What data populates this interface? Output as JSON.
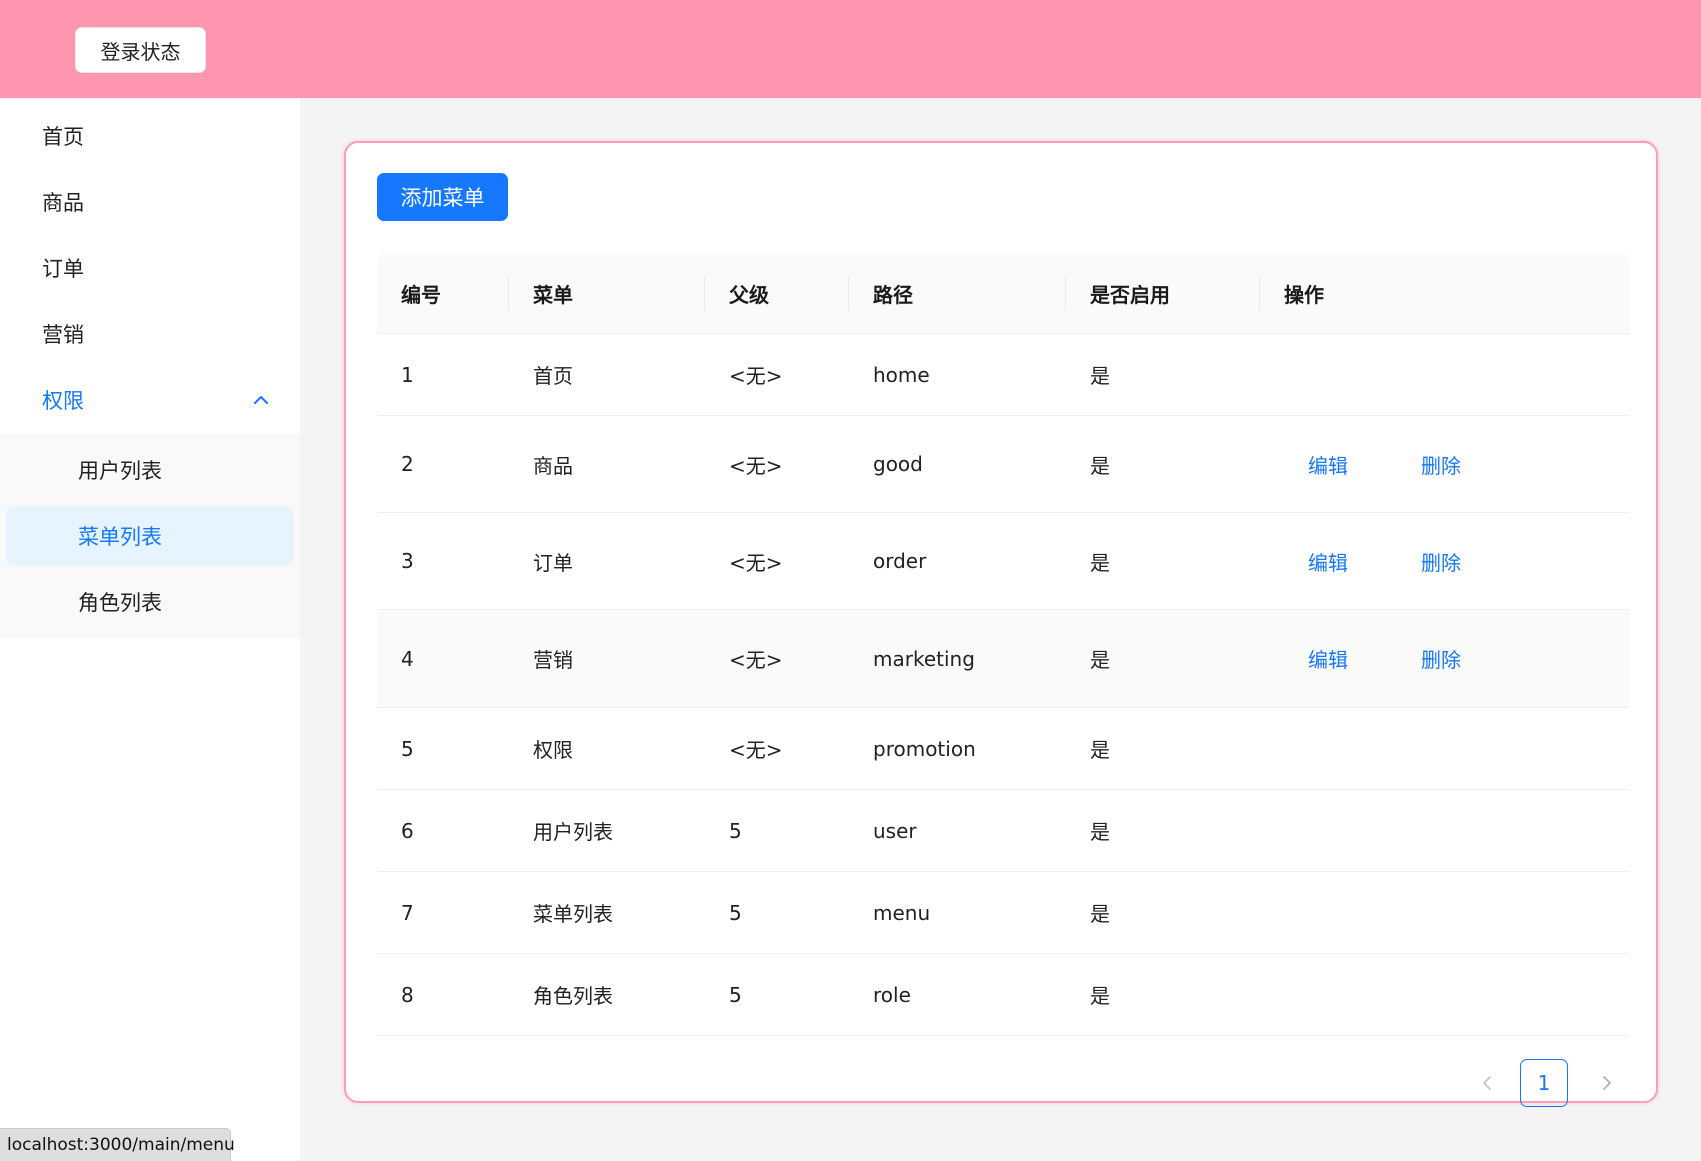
{
  "header": {
    "login_status_label": "登录状态"
  },
  "sidebar": {
    "items": [
      {
        "label": "首页"
      },
      {
        "label": "商品"
      },
      {
        "label": "订单"
      },
      {
        "label": "营销"
      },
      {
        "label": "权限",
        "expanded": true
      }
    ],
    "submenu": [
      {
        "label": "用户列表"
      },
      {
        "label": "菜单列表",
        "active": true
      },
      {
        "label": "角色列表"
      }
    ]
  },
  "toolbar": {
    "add_menu_label": "添加菜单"
  },
  "table": {
    "columns": [
      "编号",
      "菜单",
      "父级",
      "路径",
      "是否启用",
      "操作"
    ],
    "actions": {
      "edit": "编辑",
      "delete": "删除"
    },
    "rows": [
      {
        "id": "1",
        "menu": "首页",
        "parent": "<无>",
        "path": "home",
        "enabled": "是",
        "actions": false
      },
      {
        "id": "2",
        "menu": "商品",
        "parent": "<无>",
        "path": "good",
        "enabled": "是",
        "actions": true
      },
      {
        "id": "3",
        "menu": "订单",
        "parent": "<无>",
        "path": "order",
        "enabled": "是",
        "actions": true
      },
      {
        "id": "4",
        "menu": "营销",
        "parent": "<无>",
        "path": "marketing",
        "enabled": "是",
        "actions": true
      },
      {
        "id": "5",
        "menu": "权限",
        "parent": "<无>",
        "path": "promotion",
        "enabled": "是",
        "actions": false
      },
      {
        "id": "6",
        "menu": "用户列表",
        "parent": "5",
        "path": "user",
        "enabled": "是",
        "actions": false
      },
      {
        "id": "7",
        "menu": "菜单列表",
        "parent": "5",
        "path": "menu",
        "enabled": "是",
        "actions": false
      },
      {
        "id": "8",
        "menu": "角色列表",
        "parent": "5",
        "path": "role",
        "enabled": "是",
        "actions": false
      }
    ]
  },
  "pagination": {
    "current_page": "1"
  },
  "status_bar": {
    "url": "localhost:3000/main/menu"
  },
  "colors": {
    "header": "#ff96b0",
    "primary": "#1677ff",
    "card_border": "#ff9cb8",
    "active_bg": "#e6f4ff"
  },
  "icons": {
    "expand": "chevron-up-icon",
    "prev": "chevron-left-icon",
    "next": "chevron-right-icon"
  }
}
